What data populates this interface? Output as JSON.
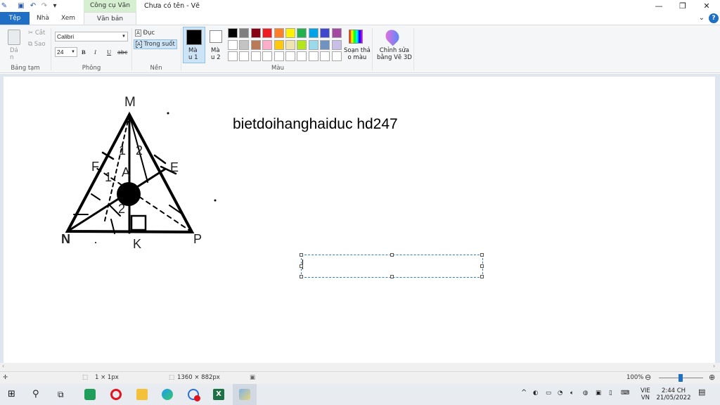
{
  "titlebar": {
    "context_tab": "Công cụ Văn bản",
    "document_title": "Chưa có tên - Vẽ",
    "minimize": "—",
    "restore": "❐",
    "close": "✕"
  },
  "tabs": {
    "file": "Tệp",
    "home": "Nhà",
    "view": "Xem",
    "text": "Văn bản",
    "help": "?"
  },
  "ribbon": {
    "clipboard": {
      "paste": "Dá\nn",
      "cut": "Cắt",
      "copy": "Sao",
      "label": "Bảng tạm"
    },
    "font": {
      "family": "Calibri",
      "size": "24",
      "bold": "B",
      "italic": "I",
      "underline": "U",
      "strike": "abc",
      "label": "Phông"
    },
    "background": {
      "opaque": "Đục",
      "transparent": "Trong suốt",
      "label": "Nền"
    },
    "colors": {
      "color1": "Mà\nu 1",
      "color2": "Mà\nu 2",
      "edit_colors": "Soạn thả\no màu",
      "paint3d": "Chỉnh sửa\nbằng Vẽ 3D",
      "label": "Màu",
      "color1_value": "#000000",
      "color2_value": "#ffffff",
      "row1": [
        "#000000",
        "#7f7f7f",
        "#880015",
        "#ed1c24",
        "#ff7f27",
        "#fff200",
        "#22b14c",
        "#00a2e8",
        "#3f48cc",
        "#a349a4"
      ],
      "row2": [
        "#ffffff",
        "#c3c3c3",
        "#b97a57",
        "#ffaec9",
        "#ffc90e",
        "#efe4b0",
        "#b5e61d",
        "#99d9ea",
        "#7092be",
        "#c8bfe7"
      ],
      "row3": [
        "#ffffff",
        "#ffffff",
        "#ffffff",
        "#ffffff",
        "#ffffff",
        "#ffffff",
        "#ffffff",
        "#ffffff",
        "#ffffff",
        "#ffffff"
      ]
    }
  },
  "canvas": {
    "text_label": "bietdoihanghaiduc hd247",
    "figure": {
      "M": "M",
      "N": "N",
      "P": "P",
      "K": "K",
      "E": "E",
      "A": "A",
      "F": "F",
      "n1a": "1",
      "n2a": "2",
      "n1b": "1",
      "n2b": "2"
    }
  },
  "status": {
    "pixel": "1 × 1px",
    "size": "1360 × 882px",
    "zoom": "100%"
  },
  "taskbar": {
    "lang_top": "VIE",
    "lang_bottom": "VN",
    "time": "2:44 CH",
    "date": "21/05/2022"
  }
}
